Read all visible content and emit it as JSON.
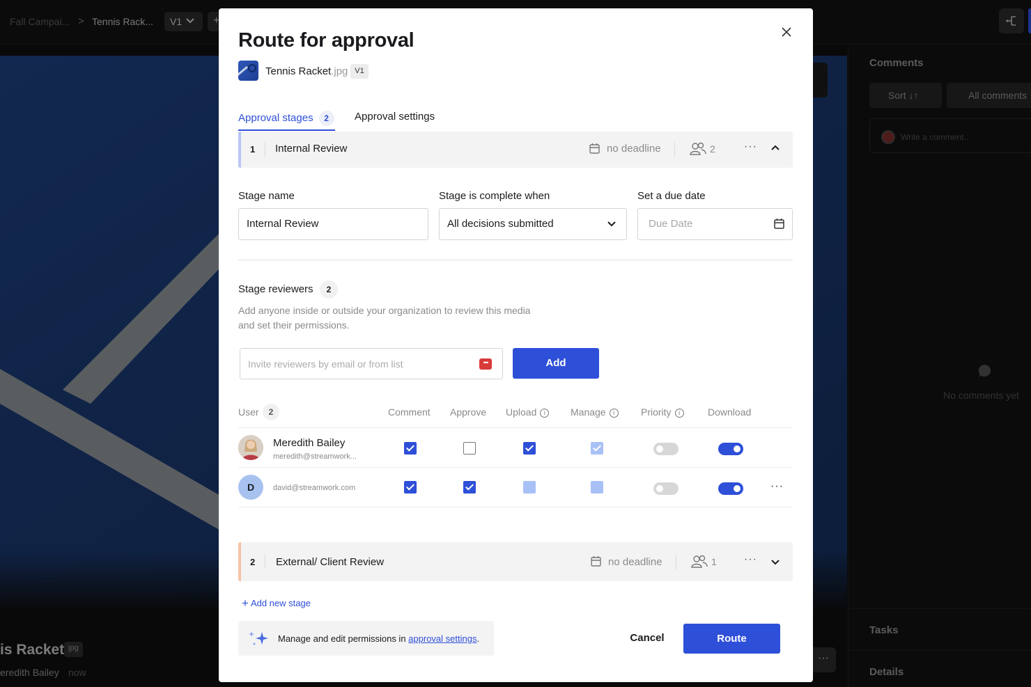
{
  "app": {
    "breadcrumb": {
      "project": "Fall Campai...",
      "asset": "Tennis Rack..."
    },
    "version_label": "V1",
    "add_glyph": "+",
    "asset_footer": {
      "name": "is Racket",
      "ext": "jpg",
      "author": "eredith Bailey",
      "time": "now"
    },
    "more_glyph": "···"
  },
  "comments_panel": {
    "title": "Comments",
    "sort_label": "Sort ↓↑",
    "filter_label": "All comments",
    "input_placeholder": "Write a comment..",
    "empty_text": "No comments yet",
    "tasks_label": "Tasks",
    "details_label": "Details"
  },
  "modal": {
    "title": "Route for approval",
    "file": {
      "name": "Tennis Racket",
      "ext": ".jpg",
      "version": "V1"
    },
    "tabs": {
      "stages_label": "Approval stages",
      "stages_count": "2",
      "settings_label": "Approval settings"
    },
    "stage1": {
      "number": "1",
      "name": "Internal Review",
      "deadline": "no deadline",
      "users": "2",
      "more": "···"
    },
    "form": {
      "stage_name_label": "Stage name",
      "stage_name_value": "Internal Review",
      "complete_label": "Stage is complete when",
      "complete_value": "All decisions submitted",
      "due_label": "Set a due date",
      "due_placeholder": "Due Date"
    },
    "reviewers": {
      "title": "Stage reviewers",
      "count": "2",
      "description": "Add anyone inside or outside your organization to review this media and set their permissions.",
      "invite_placeholder": "Invite reviewers by email or from list",
      "key_icon_text": "•••",
      "add_label": "Add"
    },
    "table": {
      "headers": {
        "user": "User",
        "user_count": "2",
        "comment": "Comment",
        "approve": "Approve",
        "upload": "Upload",
        "manage": "Manage",
        "priority": "Priority",
        "download": "Download"
      },
      "info_glyph": "i",
      "rows": [
        {
          "name": "Meredith Bailey",
          "email": "meredith@streamwork...",
          "initial": ""
        },
        {
          "name": "",
          "email": "david@streamwork.com",
          "initial": "D",
          "more": "···"
        }
      ]
    },
    "stage2": {
      "number": "2",
      "name": "External/ Client Review",
      "deadline": "no deadline",
      "users": "1",
      "more": "···"
    },
    "add_stage_plus": "+",
    "add_stage_label": "Add new stage",
    "tip": {
      "text": "Manage and edit permissions in ",
      "link": "approval settings",
      "end": "."
    },
    "cancel_label": "Cancel",
    "route_label": "Route"
  },
  "colors": {
    "accent": "#2e4fd8",
    "stage1_accent": "#b9c6f4",
    "stage2_accent": "#f4c4a8"
  }
}
